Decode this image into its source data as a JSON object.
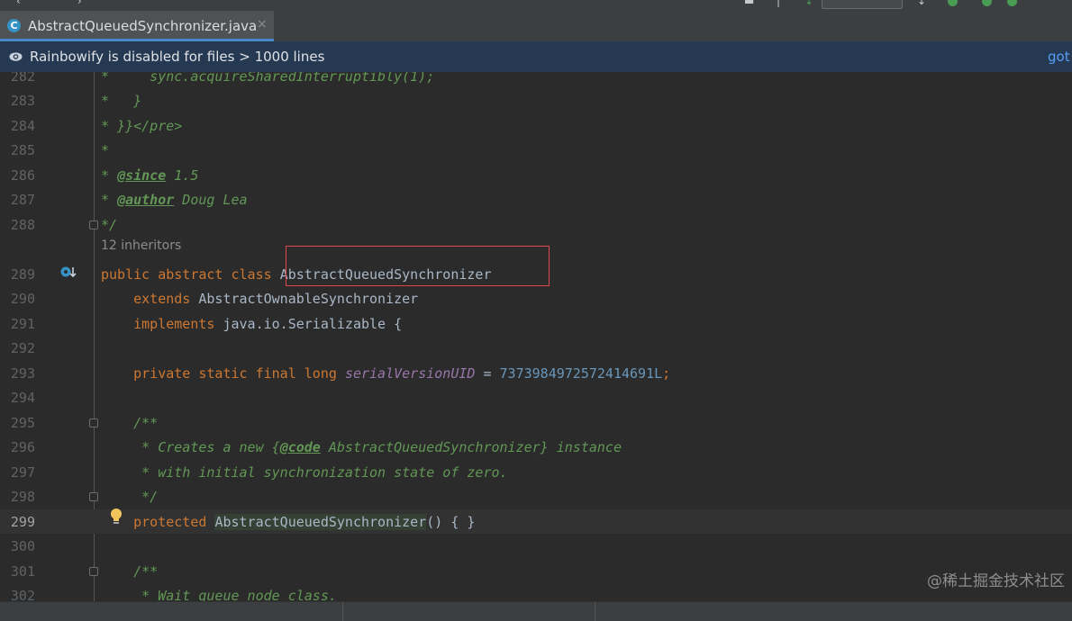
{
  "tab": {
    "label": "AbstractQueuedSynchronizer.java",
    "close": "×",
    "icon": "C"
  },
  "banner": {
    "text": "Rainbowify is disabled for files > 1000 lines",
    "link": "got"
  },
  "editor": {
    "inherit_hint": "12 inheritors",
    "current_line": "299",
    "lines": [
      {
        "n": "282",
        "segs": [
          {
            "t": "* ",
            "c": "cm"
          },
          {
            "t": "    sync.acquireSharedInterruptibly(1);",
            "c": "cm"
          }
        ]
      },
      {
        "n": "283",
        "segs": [
          {
            "t": "*   }",
            "c": "cm"
          }
        ]
      },
      {
        "n": "284",
        "segs": [
          {
            "t": "* }}</pre>",
            "c": "cm"
          }
        ]
      },
      {
        "n": "285",
        "segs": [
          {
            "t": "*",
            "c": "cm"
          }
        ]
      },
      {
        "n": "286",
        "segs": [
          {
            "t": "* ",
            "c": "cm"
          },
          {
            "t": "@since",
            "c": "tag"
          },
          {
            "t": " 1.5",
            "c": "cm"
          }
        ]
      },
      {
        "n": "287",
        "segs": [
          {
            "t": "* ",
            "c": "cm"
          },
          {
            "t": "@author",
            "c": "tag"
          },
          {
            "t": " Doug Lea",
            "c": "cm"
          }
        ]
      },
      {
        "n": "288",
        "segs": [
          {
            "t": "*/",
            "c": "cm"
          }
        ]
      },
      {
        "n": "289",
        "segs": [
          {
            "t": "public abstract class ",
            "c": "kw"
          },
          {
            "t": "AbstractQueuedSynchronizer",
            "c": "pl"
          }
        ]
      },
      {
        "n": "290",
        "segs": [
          {
            "t": "    extends ",
            "c": "kw"
          },
          {
            "t": "AbstractOwnableSynchronizer",
            "c": "pl"
          }
        ]
      },
      {
        "n": "291",
        "segs": [
          {
            "t": "    implements ",
            "c": "kw"
          },
          {
            "t": "java.io.Serializable {",
            "c": "pl"
          }
        ]
      },
      {
        "n": "292",
        "segs": []
      },
      {
        "n": "293",
        "segs": [
          {
            "t": "    private static final long ",
            "c": "kw"
          },
          {
            "t": "serialVersionUID",
            "c": "fld"
          },
          {
            "t": " = ",
            "c": "pl"
          },
          {
            "t": "7373984972572414691L",
            "c": "num"
          },
          {
            "t": ";",
            "c": "kw"
          }
        ]
      },
      {
        "n": "294",
        "segs": []
      },
      {
        "n": "295",
        "segs": [
          {
            "t": "    /**",
            "c": "cm"
          }
        ]
      },
      {
        "n": "296",
        "segs": [
          {
            "t": "     * Creates a new {",
            "c": "cm"
          },
          {
            "t": "@code",
            "c": "tag"
          },
          {
            "t": " AbstractQueuedSynchronizer} instance",
            "c": "cm"
          }
        ]
      },
      {
        "n": "297",
        "segs": [
          {
            "t": "     * with initial synchronization state of zero.",
            "c": "cm"
          }
        ]
      },
      {
        "n": "298",
        "segs": [
          {
            "t": "     */",
            "c": "cm"
          }
        ]
      },
      {
        "n": "299",
        "segs": [
          {
            "t": "    protected ",
            "c": "kw"
          },
          {
            "t": "AbstractQueuedSynchronizer",
            "c": "hl"
          },
          {
            "t": "() { }",
            "c": "pl"
          }
        ]
      },
      {
        "n": "300",
        "segs": []
      },
      {
        "n": "301",
        "segs": [
          {
            "t": "    /**",
            "c": "cm"
          }
        ]
      },
      {
        "n": "302",
        "segs": [
          {
            "t": "     * Wait queue node class.",
            "c": "cm"
          }
        ]
      }
    ]
  },
  "watermark": "@稀土掘金技术社区",
  "colors": {
    "keyword": "#cc7832",
    "comment": "#629755",
    "field": "#9876aa",
    "number": "#6897bb",
    "plain": "#a9b7c6",
    "highlight_box": "#e0474b"
  }
}
